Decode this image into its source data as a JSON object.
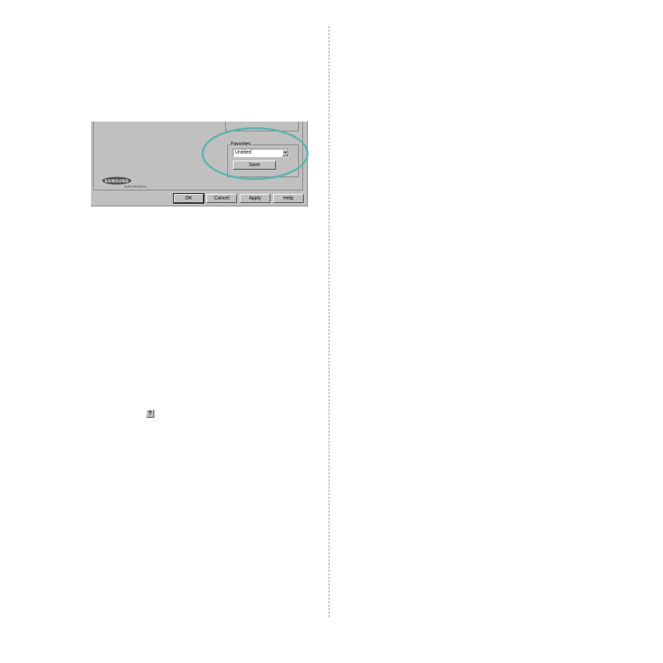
{
  "dialog": {
    "favorites": {
      "legend": "Favorites",
      "selected_value": "Untitled",
      "save_label": "Save"
    },
    "buttons": {
      "ok": "OK",
      "cancel": "Cancel",
      "apply": "Apply",
      "help": "Help"
    },
    "logo": {
      "brand": "SAMSUNG",
      "sub": "ELECTRONICS"
    }
  },
  "help_icon_glyph": "?",
  "colors": {
    "highlight_oval": "#5db3ad",
    "dialog_face": "#c0c0c0"
  }
}
